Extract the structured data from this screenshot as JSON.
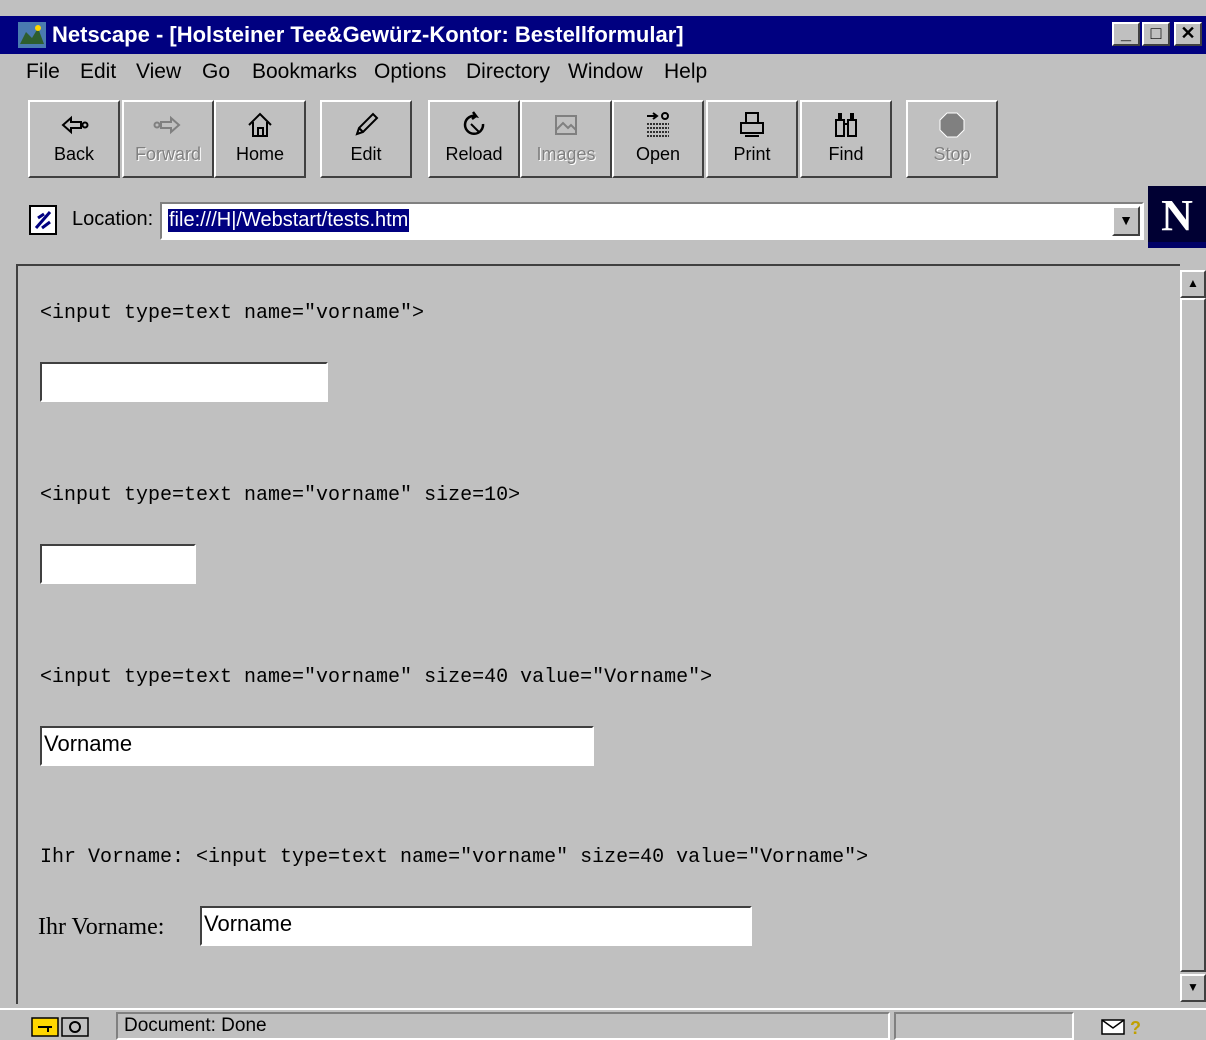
{
  "window": {
    "title": "Netscape - [Holsteiner Tee&Gewürz-Kontor: Bestellformular]",
    "controls": [
      "minimize",
      "maximize",
      "close"
    ]
  },
  "menu": {
    "items": [
      "File",
      "Edit",
      "View",
      "Go",
      "Bookmarks",
      "Options",
      "Directory",
      "Window",
      "Help"
    ]
  },
  "toolbar": {
    "buttons": [
      {
        "label": "Back",
        "icon": "back-arrow-icon",
        "enabled": true
      },
      {
        "label": "Forward",
        "icon": "forward-arrow-icon",
        "enabled": false
      },
      {
        "label": "Home",
        "icon": "home-icon",
        "enabled": true
      },
      {
        "label": "Edit",
        "icon": "pencil-icon",
        "enabled": true
      },
      {
        "label": "Reload",
        "icon": "reload-icon",
        "enabled": true
      },
      {
        "label": "Images",
        "icon": "images-icon",
        "enabled": false
      },
      {
        "label": "Open",
        "icon": "open-icon",
        "enabled": true
      },
      {
        "label": "Print",
        "icon": "printer-icon",
        "enabled": true
      },
      {
        "label": "Find",
        "icon": "binoculars-icon",
        "enabled": true
      },
      {
        "label": "Stop",
        "icon": "stop-icon",
        "enabled": false
      }
    ]
  },
  "location": {
    "label": "Location:",
    "value": "file:///H|/Webstart/tests.htm"
  },
  "content": {
    "examples": [
      {
        "code": "<input type=text name=\"vorname\">",
        "value": ""
      },
      {
        "code": "<input type=text name=\"vorname\" size=10>",
        "value": ""
      },
      {
        "code": "<input type=text name=\"vorname\" size=40 value=\"Vorname\">",
        "value": "Vorname"
      },
      {
        "code": "Ihr Vorname: <input type=text name=\"vorname\" size=40 value=\"Vorname\">",
        "label": "Ihr Vorname:",
        "value": "Vorname"
      }
    ]
  },
  "status": {
    "text": "Document: Done"
  },
  "colors": {
    "titlebar": "#000080",
    "face": "#c0c0c0",
    "selection": "#000080"
  }
}
